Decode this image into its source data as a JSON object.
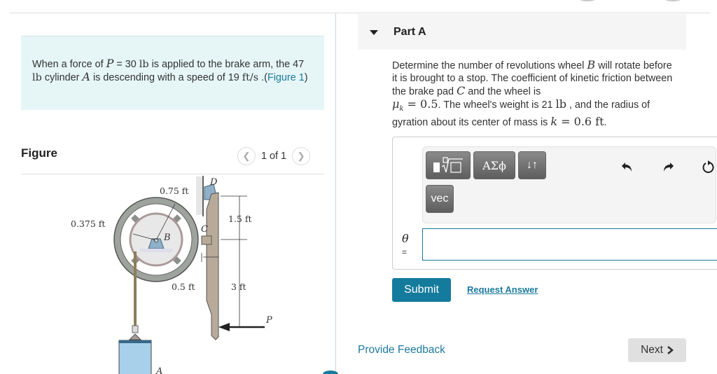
{
  "problem": {
    "text_parts": [
      "When a force of ",
      "P",
      " = 30 ",
      "lb",
      " is applied to the brake arm, the 47 ",
      "lb",
      " cylinder ",
      "A",
      " is descending with a speed of 19 ",
      "ft/s",
      " .("
    ],
    "figure_link": "Figure 1",
    "close_paren": ")"
  },
  "figure": {
    "title": "Figure",
    "prev_icon": "chevron-left",
    "next_icon": "chevron-right",
    "counter": "1 of 1",
    "labels": {
      "r_outer": "0.75 ft",
      "r_inner": "0.375 ft",
      "pad_offset": "0.5 ft",
      "d_to_c": "1.5 ft",
      "c_to_p": "3 ft",
      "point_b": "B",
      "point_c": "C",
      "point_d": "D",
      "point_a": "A",
      "force_p": "P"
    }
  },
  "part": {
    "title": "Part A",
    "question_parts": {
      "p1": "Determine the number of revolutions wheel ",
      "B": "B",
      "p2": " will rotate before it is brought to a stop. The coefficient of kinetic friction between the brake pad ",
      "C": "C",
      "p3": " and the wheel is ",
      "mu": "μ",
      "mu_sub": "k",
      "mu_val": " = 0.5",
      "p4": ". The wheel's weight is 21 ",
      "lb": "lb",
      "p5": " , and the radius of gyration about its center of mass is ",
      "k": "k",
      "k_val": " = 0.6 ft",
      "p6": "."
    }
  },
  "toolbar": {
    "templates_label": "templates",
    "greek_label": "ΑΣϕ",
    "arrows_label": "↓↑",
    "vec_label": "vec",
    "undo_icon": "undo",
    "redo_icon": "redo",
    "reset_icon": "reset"
  },
  "answer": {
    "variable": "θ",
    "equals": "=",
    "value": ""
  },
  "actions": {
    "submit": "Submit",
    "request_answer": "Request Answer",
    "provide_feedback": "Provide Feedback",
    "next": "Next"
  },
  "colors": {
    "accent": "#147b9c",
    "link": "#1c7a9c",
    "problem_bg": "#e6f6f7",
    "header_bg": "#f5f5f5"
  }
}
